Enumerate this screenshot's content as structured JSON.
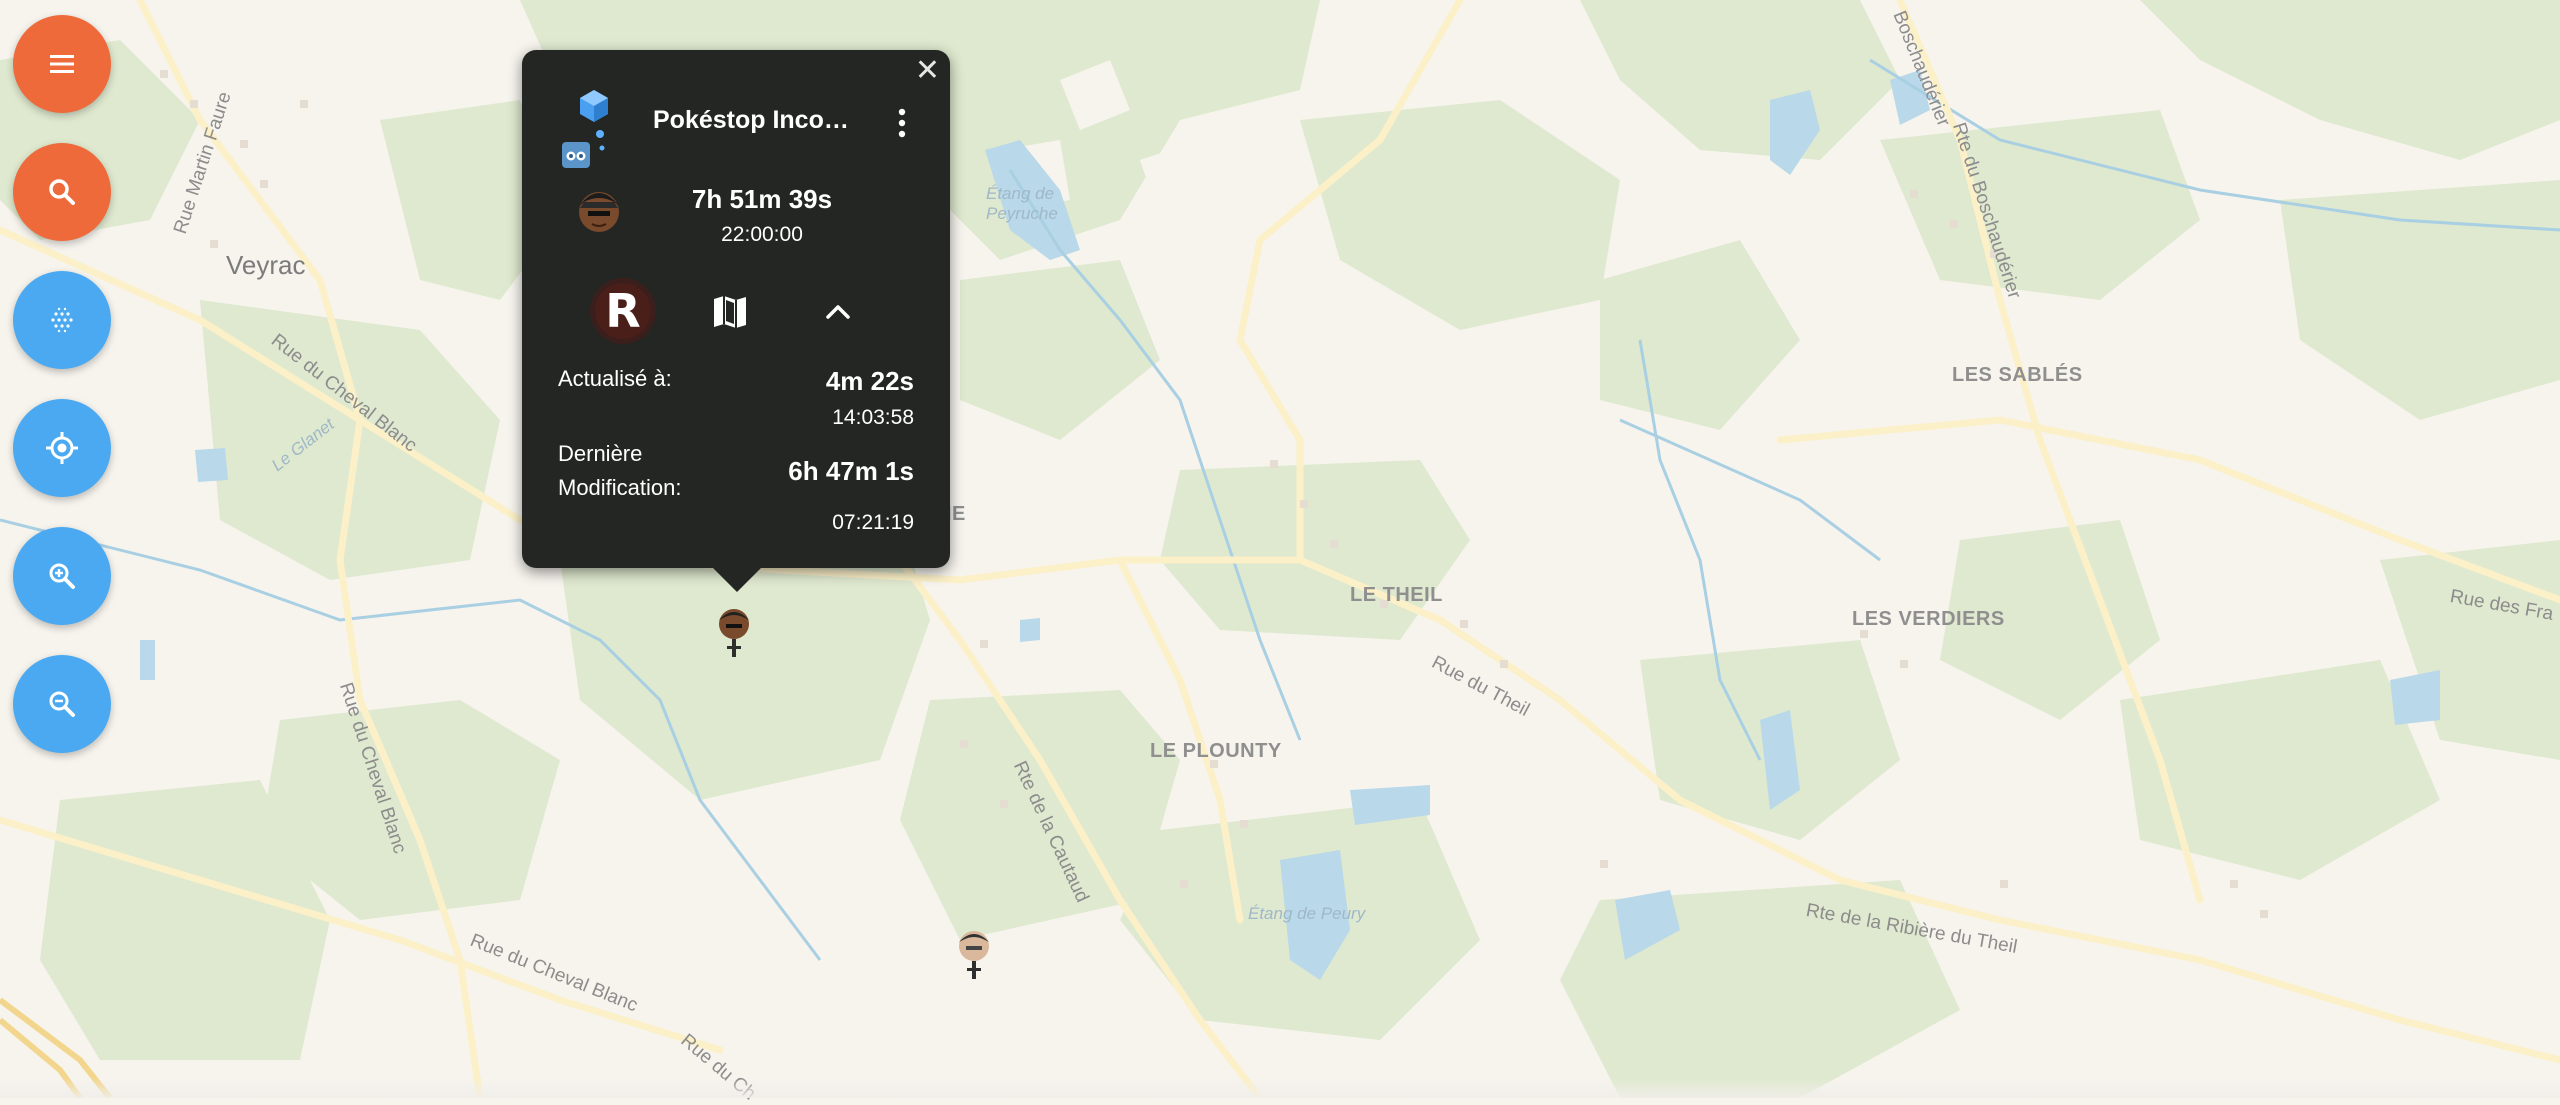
{
  "map": {
    "labels": {
      "veyrac": "Veyrac",
      "le_theil": "LE THEIL",
      "le_plounty": "LE PLOUNTY",
      "les_sables": "LES SABLÉS",
      "les_verdiers": "LES VERDIERS",
      "rue_martin_faure": "Rue Martin Faure",
      "rue_cheval_blanc_1": "Rue du Cheval Blanc",
      "rue_cheval_blanc_2": "Rue du Cheval Blanc",
      "rue_cheval_blanc_3": "Rue du Cheval Blanc",
      "rue_ch": "Rue du Ch",
      "le_glanet": "Le Glanet",
      "etang_peyruche": "Étang de Peyruche",
      "etang_peury": "Étang de Peury",
      "rue_du_theil": "Rue du Theil",
      "rte_cautaud": "Rte de la Cautaud",
      "rte_ribiere": "Rte de la Ribière du Theil",
      "rue_des_fra": "Rue des Fra",
      "rte_boschaud_1": "Rte du Boschaudérier",
      "rte_boschaud_2": "Boschaudérier",
      "partial_ie": "IE"
    }
  },
  "controls": {
    "menu": "menu-icon",
    "search": "search-icon",
    "heatmap": "grid-dots-icon",
    "locate": "locate-icon",
    "zoom_in": "zoom-in-icon",
    "zoom_out": "zoom-out-icon"
  },
  "popup": {
    "close": "✕",
    "title": "Pokéstop Incon…",
    "timer": "7h 51m 39s",
    "end_time": "22:00:00",
    "updated_label": "Actualisé à:",
    "updated_ago": "4m 22s",
    "updated_time": "14:03:58",
    "modified_label_line1": "Dernière",
    "modified_label_line2": "Modification:",
    "modified_ago": "6h 47m 1s",
    "modified_time": "07:21:19",
    "rocket_letter": "R"
  },
  "colors": {
    "orange": "#ef6a3a",
    "blue": "#4aa9f1",
    "popup_bg": "#232623",
    "map_bg": "#f7f4ee",
    "green_area": "#dfe9cf",
    "water": "#b9d8e9",
    "road": "#fbf0c8"
  }
}
